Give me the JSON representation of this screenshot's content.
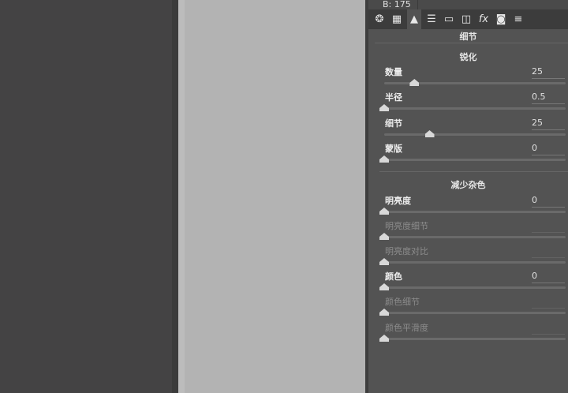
{
  "info": {
    "readout": "B: 175"
  },
  "tabs": [
    {
      "name": "basic-aperture-icon",
      "glyph": "❂"
    },
    {
      "name": "tone-curve-grid-icon",
      "glyph": "▦"
    },
    {
      "name": "detail-mountain-icon",
      "glyph": "▲"
    },
    {
      "name": "hsl-icon",
      "glyph": "☰"
    },
    {
      "name": "split-toning-icon",
      "glyph": "▭"
    },
    {
      "name": "lens-corrections-icon",
      "glyph": "◫"
    },
    {
      "name": "effects-fx-icon",
      "glyph": "fx"
    },
    {
      "name": "camera-calibration-icon",
      "glyph": "◙"
    },
    {
      "name": "presets-sliders-icon",
      "glyph": "≡"
    }
  ],
  "panel_title": "细节",
  "sharpening": {
    "title": "锐化",
    "sliders": [
      {
        "label": "数量",
        "value": "25",
        "position": 0.1667,
        "enabled": true
      },
      {
        "label": "半径",
        "value": "0.5",
        "position": 0,
        "enabled": true
      },
      {
        "label": "细节",
        "value": "25",
        "position": 0.25,
        "enabled": true
      },
      {
        "label": "蒙版",
        "value": "0",
        "position": 0,
        "enabled": true
      }
    ]
  },
  "noise": {
    "title": "减少杂色",
    "sliders": [
      {
        "label": "明亮度",
        "value": "0",
        "position": 0,
        "enabled": true
      },
      {
        "label": "明亮度细节",
        "value": "",
        "position": 0,
        "enabled": false
      },
      {
        "label": "明亮度对比",
        "value": "",
        "position": 0,
        "enabled": false
      },
      {
        "label": "颜色",
        "value": "0",
        "position": 0,
        "enabled": true
      },
      {
        "label": "颜色细节",
        "value": "",
        "position": 0,
        "enabled": false
      },
      {
        "label": "颜色平滑度",
        "value": "",
        "position": 0,
        "enabled": false
      }
    ]
  }
}
